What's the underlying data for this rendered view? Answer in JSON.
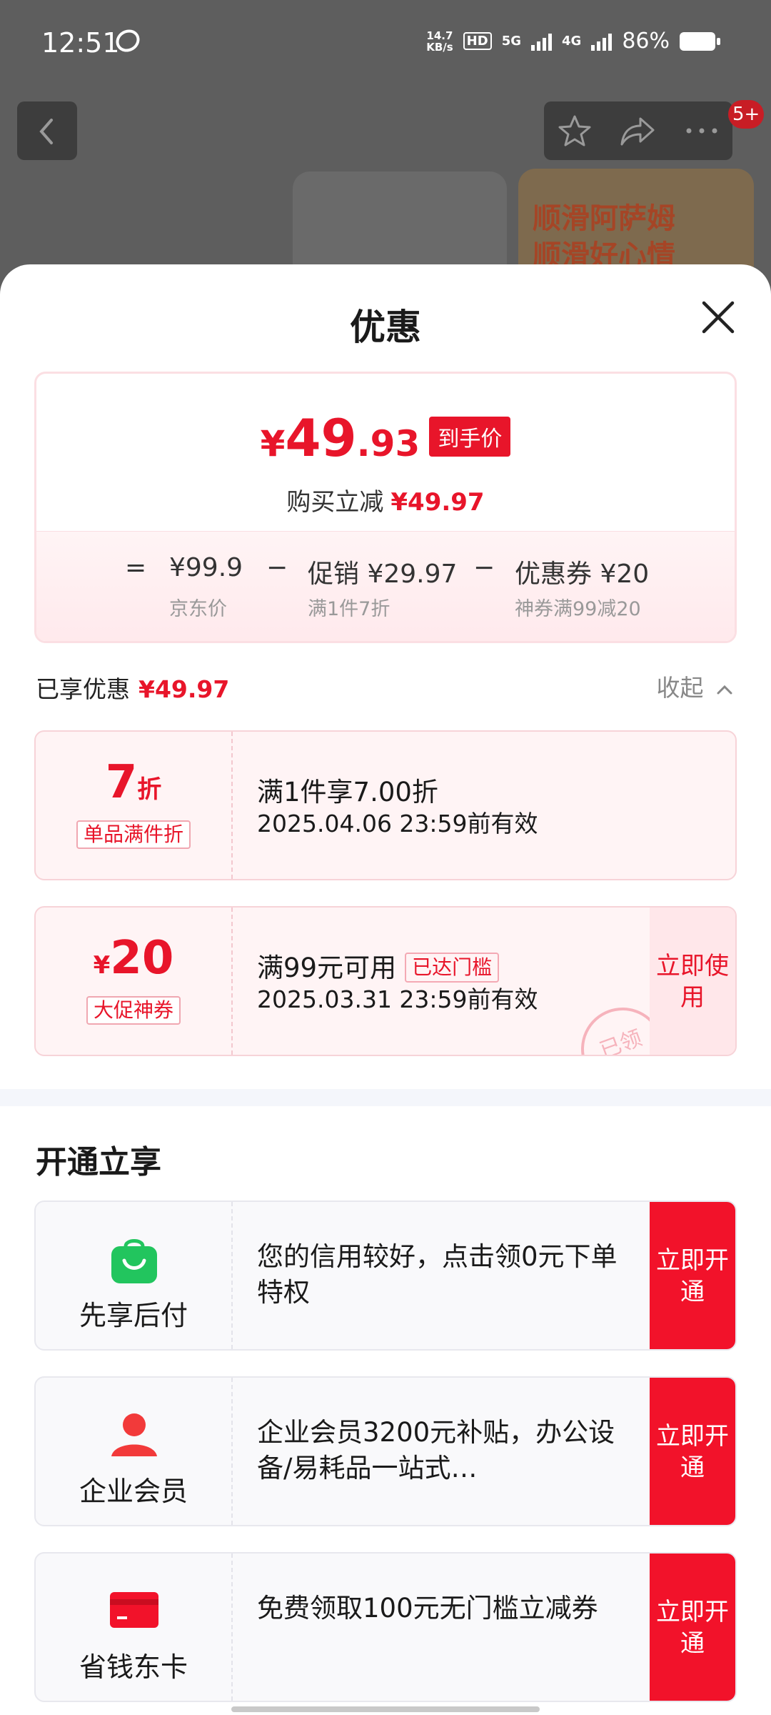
{
  "status": {
    "time": "12:51",
    "net_speed_top": "14.7",
    "net_speed_unit": "KB/s",
    "hd": "HD",
    "sig1": "5G",
    "sig2": "4G",
    "battery": "86%"
  },
  "background": {
    "cart_badge": "5+",
    "promo_line1": "顺滑阿萨姆",
    "promo_line2": "顺滑好心情"
  },
  "sheet": {
    "title": "优惠",
    "price": {
      "currency": "¥",
      "int": "49",
      "dec": ".93",
      "tag": "到手价",
      "sub_label": "购买立减",
      "sub_value": "¥49.97"
    },
    "breakdown": {
      "eq": "=",
      "jd_price": "¥99.9",
      "jd_label": "京东价",
      "minus1": "−",
      "promo": "促销 ¥29.97",
      "promo_note": "满1件7折",
      "minus2": "−",
      "coupon": "优惠券 ¥20",
      "coupon_note": "神券满99减20"
    },
    "enjoyed_label": "已享优惠",
    "enjoyed_value": "¥49.97",
    "collapse": "收起",
    "coupons": [
      {
        "big_num": "7",
        "big_suffix": "折",
        "tag": "单品满件折",
        "line1": "满1件享7.00折",
        "line2": "2025.04.06 23:59前有效"
      },
      {
        "big_prefix": "¥",
        "big_num": "20",
        "tag": "大促神券",
        "line1": "满99元可用",
        "threshold": "已达门槛",
        "line2": "2025.03.31 23:59前有效",
        "action": "立即使用",
        "stamp": "已领"
      }
    ],
    "section_title": "开通立享",
    "services": [
      {
        "name": "先享后付",
        "desc": "您的信用较好，点击领0元下单特权",
        "action": "立即开通",
        "icon": "shopping-bag-icon",
        "color": "#22c55e"
      },
      {
        "name": "企业会员",
        "desc": "企业会员3200元补贴，办公设备/易耗品一站式…",
        "action": "立即开通",
        "icon": "user-icon",
        "color": "#f23a3a"
      },
      {
        "name": "省钱东卡",
        "desc": "免费领取100元无门槛立减券",
        "action": "立即开通",
        "icon": "card-icon",
        "color": "#f2122a"
      }
    ]
  }
}
